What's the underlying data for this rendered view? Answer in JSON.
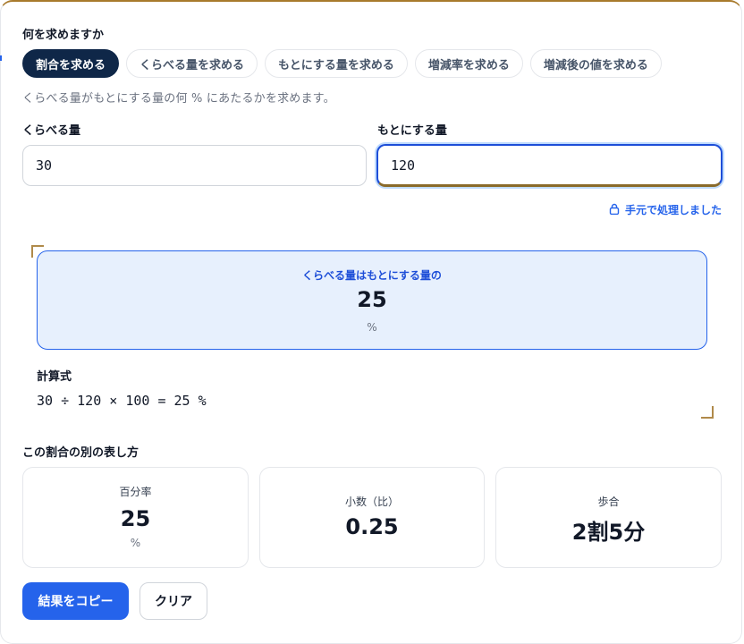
{
  "mode_section": {
    "title": "何を求めますか",
    "tabs": [
      "割合を求める",
      "くらべる量を求める",
      "もとにする量を求める",
      "増減率を求める",
      "増減後の値を求める"
    ],
    "active_index": 0,
    "description": "くらべる量がもとにする量の何 % にあたるかを求めます。"
  },
  "inputs": {
    "compare": {
      "label": "くらべる量",
      "value": "30"
    },
    "base": {
      "label": "もとにする量",
      "value": "120"
    }
  },
  "local_note": {
    "icon": "lock-icon",
    "text": "手元で処理しました"
  },
  "result": {
    "caption": "くらべる量はもとにする量の",
    "value": "25",
    "unit": "%"
  },
  "formula": {
    "title": "計算式",
    "text": "30 ÷ 120 × 100 = 25 %"
  },
  "alternatives": {
    "title": "この割合の別の表し方",
    "cards": [
      {
        "label": "百分率",
        "value": "25",
        "unit": "%"
      },
      {
        "label": "小数（比）",
        "value": "0.25"
      },
      {
        "label": "歩合",
        "value": "2割5分"
      }
    ]
  },
  "buttons": {
    "copy": "結果をコピー",
    "clear": "クリア"
  },
  "colors": {
    "active_tab": "#0f2748",
    "primary": "#2563eb",
    "result_bg": "#e7f0fd"
  }
}
